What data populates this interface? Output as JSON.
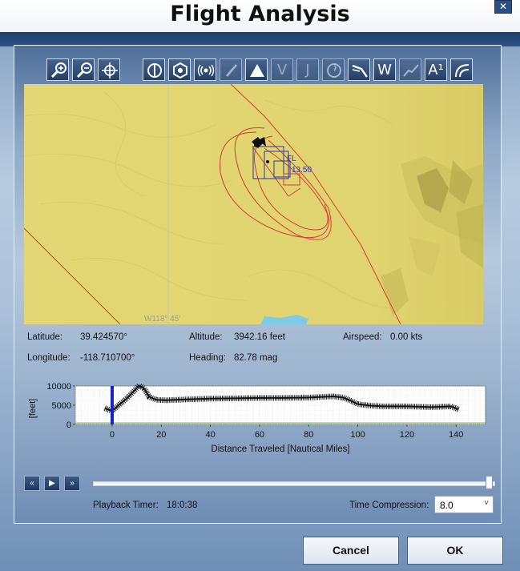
{
  "window": {
    "title": "Flight Analysis",
    "close_glyph": "✕"
  },
  "toolbar": {
    "buttons": [
      {
        "name": "zoom-in-icon",
        "enabled": true
      },
      {
        "name": "zoom-out-icon",
        "enabled": true
      },
      {
        "name": "center-crosshair-icon",
        "enabled": true
      },
      {
        "name": "half-circle-icon",
        "enabled": true
      },
      {
        "name": "hexagon-icon",
        "enabled": true
      },
      {
        "name": "radio-signal-icon",
        "enabled": true
      },
      {
        "name": "pencil-icon",
        "enabled": false
      },
      {
        "name": "triangle-icon",
        "enabled": true
      },
      {
        "name": "letter-v-icon",
        "enabled": false,
        "glyph": "V"
      },
      {
        "name": "letter-j-icon",
        "enabled": false,
        "glyph": "J"
      },
      {
        "name": "swirl-icon",
        "enabled": false
      },
      {
        "name": "tail-icon",
        "enabled": true
      },
      {
        "name": "weather-w-icon",
        "enabled": true,
        "glyph": "W"
      },
      {
        "name": "trend-line-icon",
        "enabled": false
      },
      {
        "name": "altitude-a-icon",
        "enabled": true,
        "glyph": "A¹"
      },
      {
        "name": "arc-icon",
        "enabled": true
      }
    ]
  },
  "map": {
    "waypoint_label": "FL",
    "waypoint_value": "13.50",
    "grid_label": "W118° 45'",
    "colors": {
      "terrain": "#e2d774",
      "track": "#d63a33",
      "marker": "#2836a6"
    }
  },
  "readouts": {
    "latitude_label": "Latitude:",
    "latitude_value": "39.424570°",
    "longitude_label": "Longitude:",
    "longitude_value": "-118.710700°",
    "altitude_label": "Altitude:",
    "altitude_value": "3942.16 feet",
    "heading_label": "Heading:",
    "heading_value": "82.78 mag",
    "airspeed_label": "Airspeed:",
    "airspeed_value": "0.00 kts"
  },
  "chart_data": {
    "type": "line",
    "ylabel": "[feet]",
    "xlabel": "Distance Traveled [Nautical Miles]",
    "ylim": [
      0,
      10000
    ],
    "xlim": [
      -15,
      152
    ],
    "yticks": [
      0,
      5000,
      10000
    ],
    "xticks": [
      0,
      20,
      40,
      60,
      80,
      100,
      120,
      140
    ],
    "grid": true,
    "marker_x": 0,
    "series": [
      {
        "x": [
          -3,
          0,
          3,
          6,
          9,
          11,
          13,
          15,
          18,
          22,
          30,
          40,
          50,
          60,
          70,
          80,
          90,
          94,
          97,
          100,
          105,
          110,
          120,
          130,
          138,
          141
        ],
        "y": [
          4200,
          3500,
          5200,
          6800,
          8800,
          10100,
          9400,
          7200,
          6400,
          6300,
          6500,
          6700,
          6800,
          6900,
          6900,
          7000,
          7300,
          7000,
          6200,
          5300,
          4900,
          4700,
          4700,
          4500,
          4700,
          3900
        ]
      }
    ],
    "ground": {
      "x": [
        -15,
        152
      ],
      "y": [
        400,
        400
      ]
    }
  },
  "playback": {
    "rewind_glyph": "«",
    "play_glyph": "▶",
    "forward_glyph": "»",
    "timer_label": "Playback Timer:",
    "timer_value": "18:0:38",
    "slider_position": 1.0,
    "compression_label": "Time Compression:",
    "compression_value": "8.0",
    "dropdown_glyph": "˅"
  },
  "buttons": {
    "cancel": "Cancel",
    "ok": "OK"
  }
}
